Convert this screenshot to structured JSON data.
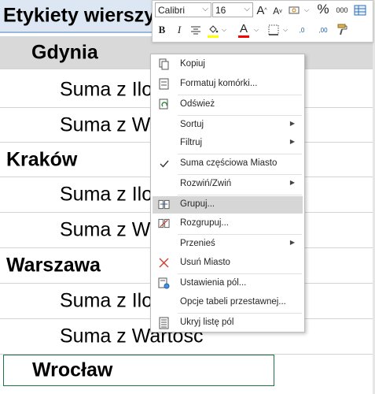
{
  "sheet": {
    "header": "Etykiety wierszy",
    "rows": [
      {
        "text": "Gdynia",
        "level": 1
      },
      {
        "text": "Suma z Ilość",
        "level": 2
      },
      {
        "text": "Suma z Wartość",
        "level": 2
      },
      {
        "text": "Kraków",
        "level": 0
      },
      {
        "text": "Suma z Ilość",
        "level": 2
      },
      {
        "text": "Suma z Wartość",
        "level": 2
      },
      {
        "text": "Warszawa",
        "level": 0
      },
      {
        "text": "Suma z Ilość",
        "level": 2
      },
      {
        "text": "Suma z Wartość",
        "level": 2
      },
      {
        "text": "Wrocław",
        "level": 0
      }
    ]
  },
  "mini_toolbar": {
    "font_name": "Calibri",
    "font_size": "16",
    "grow_font": "A",
    "shrink_font": "A",
    "currency": "%",
    "thousands": "000",
    "bold": "B",
    "italic": "I",
    "font_color_letter": "A",
    "dec_increase": ",0",
    "dec_decrease": ",00",
    "fill_color": "#ffff00",
    "font_color": "#ff0000"
  },
  "context_menu": {
    "items": [
      {
        "label": "Kopiuj",
        "icon": "copy-icon",
        "u": "K"
      },
      {
        "label": "Formatuj komórki...",
        "icon": "format-cells-icon",
        "u": "F"
      },
      {
        "label": "Odśwież",
        "icon": "refresh-icon",
        "u": "O"
      },
      {
        "label": "Sortuj",
        "icon": "",
        "submenu": true,
        "u": "S"
      },
      {
        "label": "Filtruj",
        "icon": "",
        "submenu": true,
        "u": "F"
      },
      {
        "label": "Suma częściowa Miasto",
        "icon": "check-icon",
        "checked": true
      },
      {
        "label": "Rozwiń/Zwiń",
        "icon": "",
        "submenu": true
      },
      {
        "label": "Grupuj...",
        "icon": "group-icon",
        "highlighted": true
      },
      {
        "label": "Rozgrupuj...",
        "icon": "ungroup-icon"
      },
      {
        "label": "Przenieś",
        "icon": "",
        "submenu": true
      },
      {
        "label": "Usuń Miasto",
        "icon": "remove-icon"
      },
      {
        "label": "Ustawienia pól...",
        "icon": "field-settings-icon"
      },
      {
        "label": "Opcje tabeli przestawnej...",
        "icon": ""
      },
      {
        "label": "Ukryj listę pól",
        "icon": "field-list-icon"
      }
    ]
  }
}
